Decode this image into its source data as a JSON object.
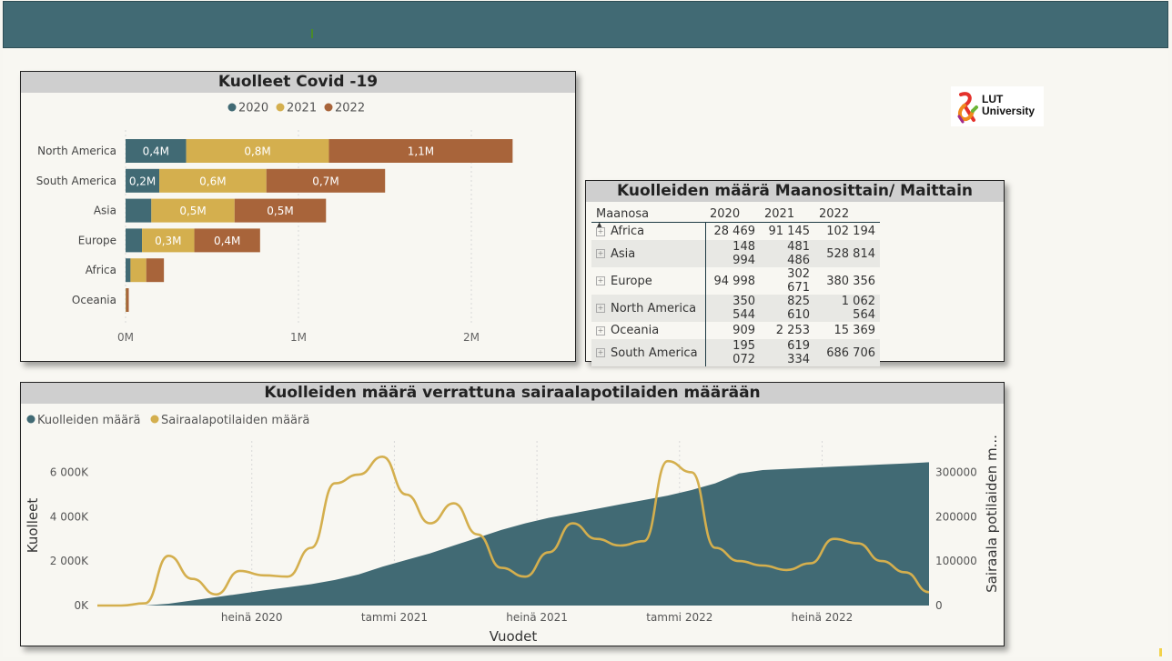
{
  "logo": {
    "line1": "LUT",
    "line2": "University"
  },
  "bar_panel": {
    "title": "Kuolleet Covid -19",
    "legend": [
      {
        "label": "2020",
        "color": "#416a74"
      },
      {
        "label": "2021",
        "color": "#d4af4e"
      },
      {
        "label": "2022",
        "color": "#a8643a"
      }
    ],
    "x_ticks": [
      "0M",
      "1M",
      "2M"
    ]
  },
  "table_panel": {
    "title": "Kuolleiden määrä Maanosittain/ Maittain",
    "headers": [
      "Maanosa",
      "2020",
      "2021",
      "2022"
    ],
    "rows": [
      [
        "Africa",
        "28 469",
        "91 145",
        "102 194"
      ],
      [
        "Asia",
        "148 994",
        "481 486",
        "528 814"
      ],
      [
        "Europe",
        "94 998",
        "302 671",
        "380 356"
      ],
      [
        "North America",
        "350 544",
        "825 610",
        "1 062 564"
      ],
      [
        "Oceania",
        "909",
        "2 253",
        "15 369"
      ],
      [
        "South America",
        "195 072",
        "619 334",
        "686 706"
      ]
    ]
  },
  "line_panel": {
    "title": "Kuolleiden määrä verrattuna sairaalapotilaiden määrään",
    "legend": [
      {
        "label": "Kuolleiden määrä",
        "color": "#416a74"
      },
      {
        "label": "Sairaalapotilaiden määrä",
        "color": "#d4af4e"
      }
    ]
  },
  "chart_data": [
    {
      "type": "bar",
      "title": "Kuolleet Covid -19",
      "orientation": "horizontal",
      "stacked": true,
      "categories": [
        "North America",
        "South America",
        "Asia",
        "Europe",
        "Africa",
        "Oceania"
      ],
      "series": [
        {
          "name": "2020",
          "values": [
            350544,
            195072,
            148994,
            94998,
            28469,
            909
          ],
          "labels": [
            "0,4M",
            "0,2M",
            "",
            "",
            "",
            ""
          ]
        },
        {
          "name": "2021",
          "values": [
            825610,
            619334,
            481486,
            302671,
            91145,
            2253
          ],
          "labels": [
            "0,8M",
            "0,6M",
            "0,5M",
            "0,3M",
            "",
            ""
          ]
        },
        {
          "name": "2022",
          "values": [
            1062564,
            686706,
            528814,
            380356,
            102194,
            15369
          ],
          "labels": [
            "1,1M",
            "0,7M",
            "0,5M",
            "0,4M",
            "",
            ""
          ]
        }
      ],
      "xlim": [
        0,
        2200000
      ],
      "x_ticks": [
        "0M",
        "1M",
        "2M"
      ],
      "legend_position": "top"
    },
    {
      "type": "line",
      "title": "Kuolleiden määrä verrattuna sairaalapotilaiden määrään",
      "xlabel": "Vuodet",
      "ylabel_left": "Kuolleet",
      "ylabel_right": "Sairaala potilaiden m...",
      "x_ticks": [
        "heinä 2020",
        "tammi 2021",
        "heinä 2021",
        "tammi 2022",
        "heinä 2022"
      ],
      "x_range": [
        "2020-01",
        "2022-12"
      ],
      "y_left_ticks": [
        "0K",
        "2 000K",
        "4 000K",
        "6 000K"
      ],
      "y_left_range": [
        0,
        7000000
      ],
      "y_right_ticks": [
        "0",
        "100000",
        "200000",
        "300000"
      ],
      "y_right_range": [
        0,
        350000
      ],
      "legend_position": "top-left",
      "series": [
        {
          "name": "Kuolleiden määrä",
          "axis": "left",
          "style": "area",
          "x": [
            "2020-01",
            "2020-02",
            "2020-03",
            "2020-04",
            "2020-05",
            "2020-06",
            "2020-07",
            "2020-08",
            "2020-09",
            "2020-10",
            "2020-11",
            "2020-12",
            "2021-01",
            "2021-02",
            "2021-03",
            "2021-04",
            "2021-05",
            "2021-06",
            "2021-07",
            "2021-08",
            "2021-09",
            "2021-10",
            "2021-11",
            "2021-12",
            "2022-01",
            "2022-02",
            "2022-03",
            "2022-04",
            "2022-05",
            "2022-06",
            "2022-07",
            "2022-08",
            "2022-09",
            "2022-10",
            "2022-11",
            "2022-12"
          ],
          "values": [
            0,
            0,
            0,
            80000,
            230000,
            380000,
            530000,
            680000,
            820000,
            960000,
            1150000,
            1400000,
            1750000,
            2050000,
            2350000,
            2700000,
            3050000,
            3400000,
            3700000,
            3950000,
            4150000,
            4350000,
            4550000,
            4750000,
            4950000,
            5200000,
            5500000,
            5950000,
            6100000,
            6150000,
            6200000,
            6250000,
            6300000,
            6350000,
            6400000,
            6450000
          ]
        },
        {
          "name": "Sairaalapotilaiden määrä",
          "axis": "right",
          "style": "line",
          "x": [
            "2020-01",
            "2020-02",
            "2020-03",
            "2020-04",
            "2020-05",
            "2020-06",
            "2020-07",
            "2020-08",
            "2020-09",
            "2020-10",
            "2020-11",
            "2020-12",
            "2021-01",
            "2021-02",
            "2021-03",
            "2021-04",
            "2021-05",
            "2021-06",
            "2021-07",
            "2021-08",
            "2021-09",
            "2021-10",
            "2021-11",
            "2021-12",
            "2022-01",
            "2022-02",
            "2022-03",
            "2022-04",
            "2022-05",
            "2022-06",
            "2022-07",
            "2022-08",
            "2022-09",
            "2022-10",
            "2022-11",
            "2022-12"
          ],
          "values": [
            0,
            0,
            5000,
            112000,
            60000,
            25000,
            78000,
            68000,
            65000,
            130000,
            275000,
            295000,
            335000,
            250000,
            185000,
            230000,
            160000,
            85000,
            65000,
            120000,
            185000,
            150000,
            135000,
            145000,
            325000,
            300000,
            130000,
            100000,
            90000,
            80000,
            95000,
            150000,
            140000,
            100000,
            75000,
            30000
          ]
        }
      ]
    }
  ]
}
